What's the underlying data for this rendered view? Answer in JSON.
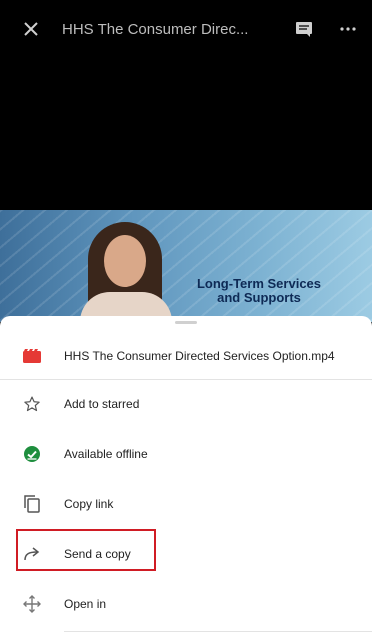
{
  "header": {
    "title": "HHS The Consumer Direc..."
  },
  "video": {
    "caption_line1": "Long-Term Services",
    "caption_line2": "and Supports"
  },
  "sheet": {
    "file_name": "HHS The Consumer Directed Services Option.mp4",
    "items": [
      {
        "label": "Add to starred",
        "icon": "star-outline-icon"
      },
      {
        "label": "Available offline",
        "icon": "offline-check-icon"
      },
      {
        "label": "Copy link",
        "icon": "copy-icon"
      },
      {
        "label": "Send a copy",
        "icon": "share-arrow-icon"
      },
      {
        "label": "Open in",
        "icon": "open-in-icon"
      }
    ]
  },
  "colors": {
    "video_file_icon": "#e53935",
    "offline_green": "#1e8e3e",
    "highlight_red": "#d01c24"
  }
}
